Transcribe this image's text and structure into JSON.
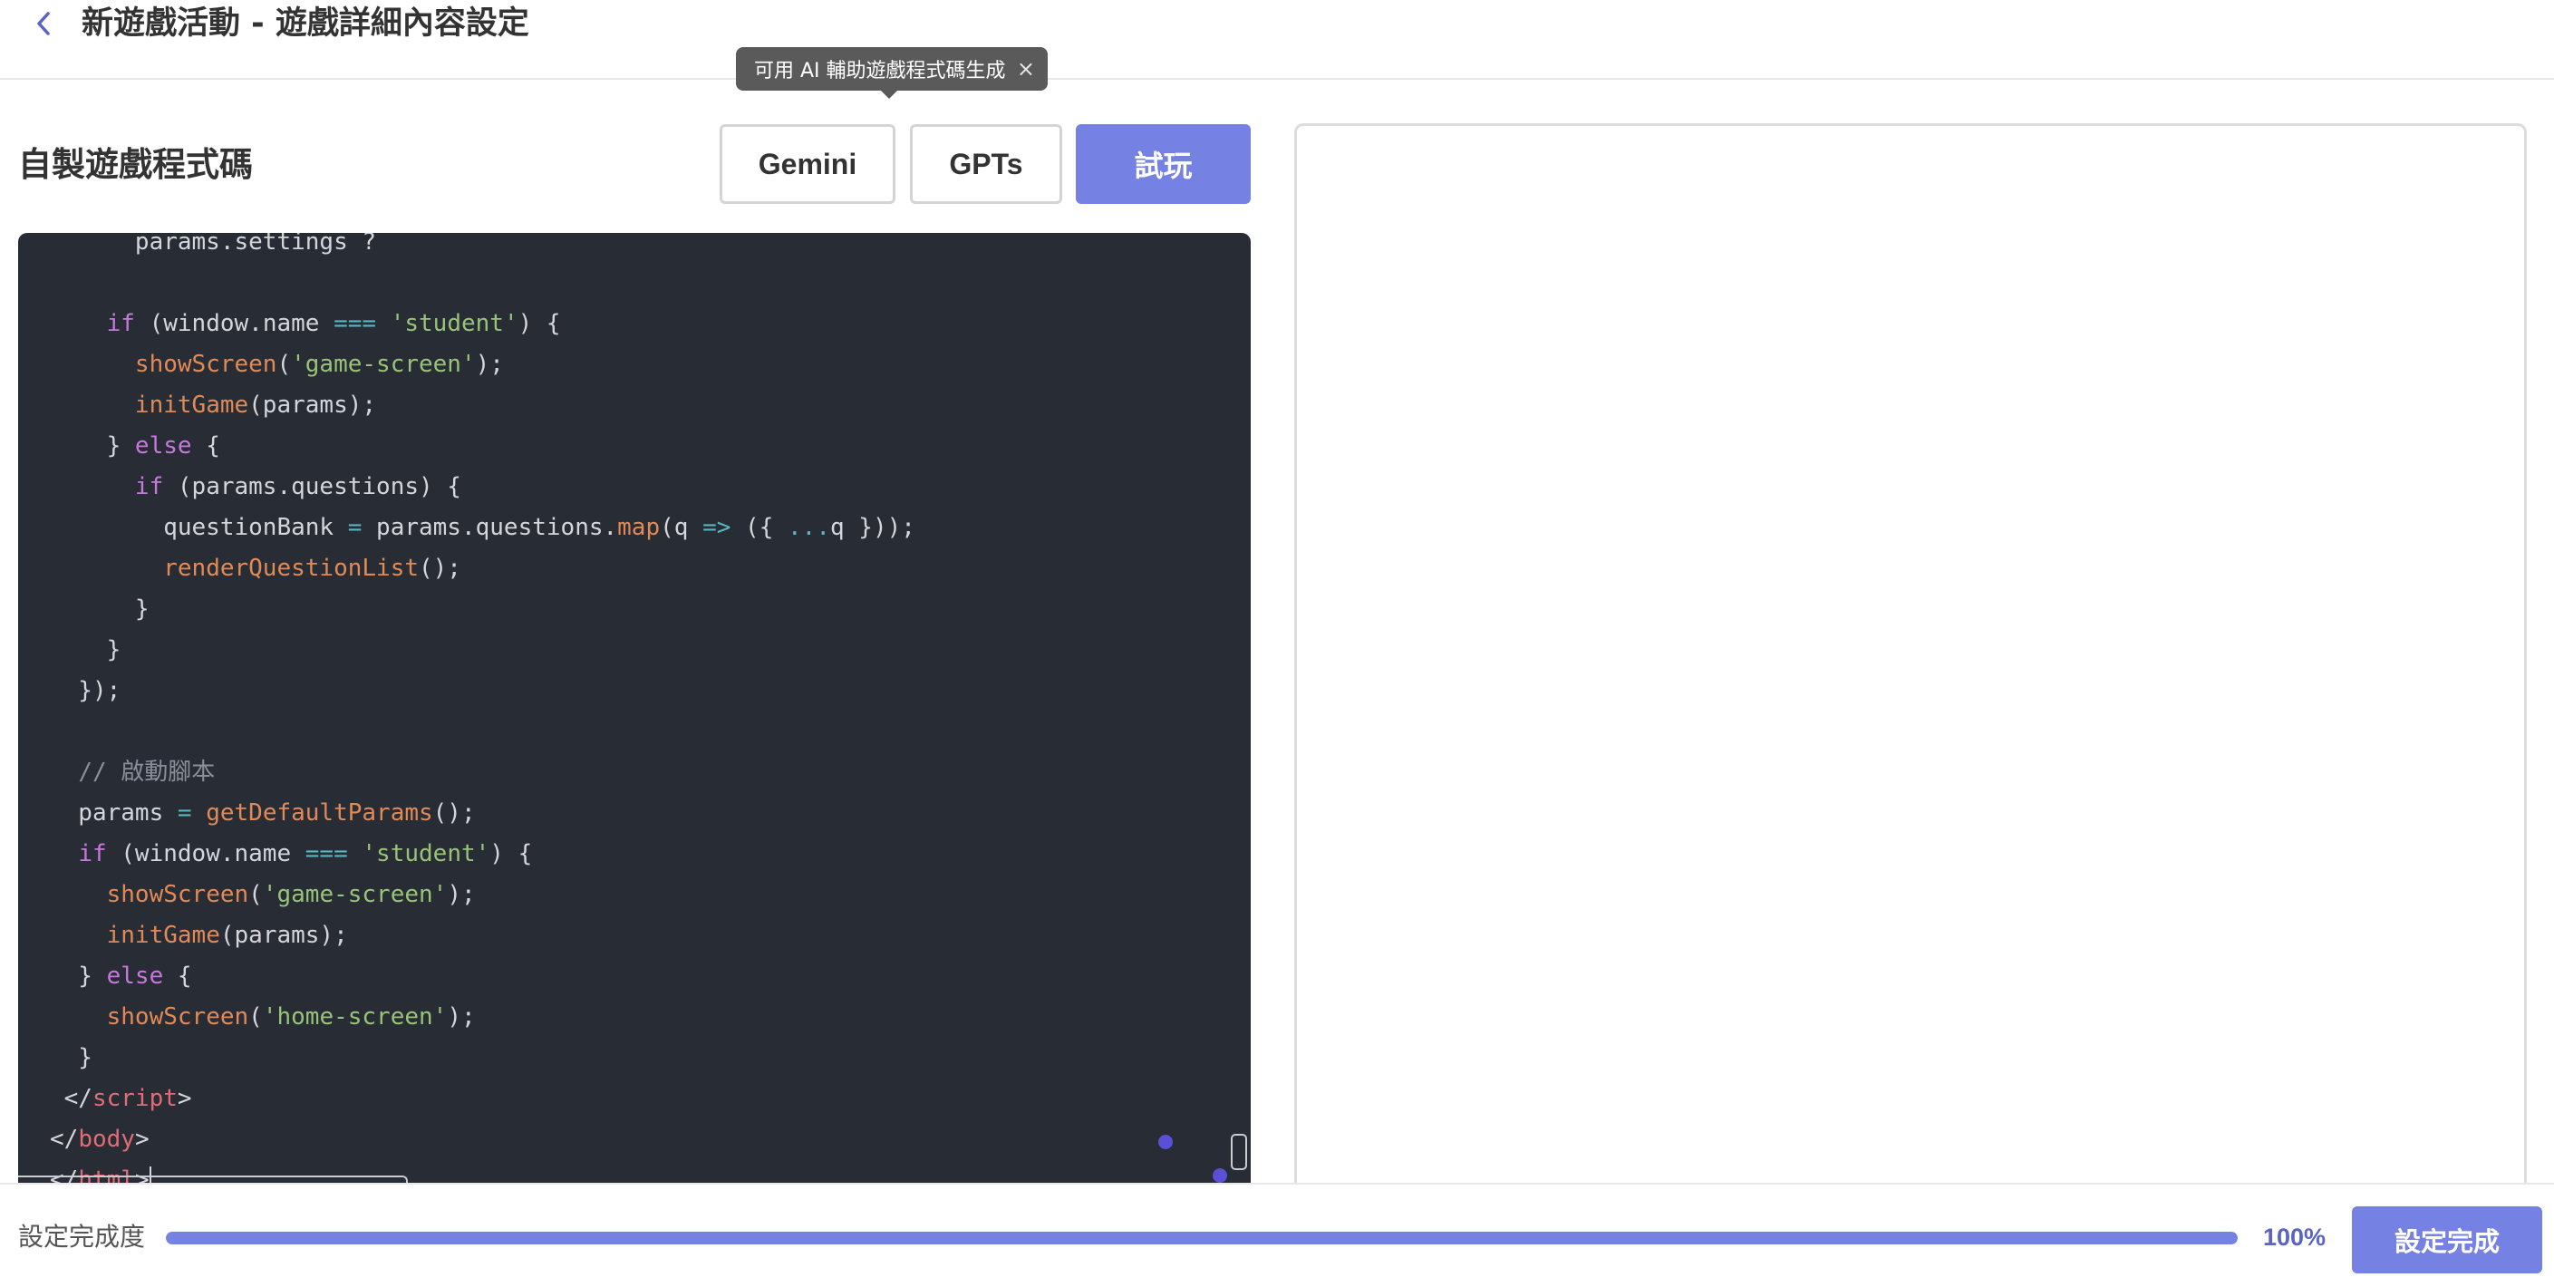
{
  "header": {
    "title": "新遊戲活動 - 遊戲詳細內容設定"
  },
  "tooltip": {
    "text": "可用 AI 輔助遊戲程式碼生成",
    "close_glyph": "×"
  },
  "left_panel": {
    "title": "自製遊戲程式碼",
    "buttons": {
      "gemini": "Gemini",
      "gpts": "GPTs",
      "try": "試玩"
    }
  },
  "editor": {
    "lines": [
      [
        {
          "t": "      params.settings ?",
          "c": ""
        }
      ],
      [
        {
          "t": "",
          "c": ""
        }
      ],
      [
        {
          "t": "    ",
          "c": ""
        },
        {
          "t": "if",
          "c": "kw"
        },
        {
          "t": " (window.name ",
          "c": ""
        },
        {
          "t": "===",
          "c": "op"
        },
        {
          "t": " ",
          "c": ""
        },
        {
          "t": "'student'",
          "c": "str"
        },
        {
          "t": ") {",
          "c": ""
        }
      ],
      [
        {
          "t": "      ",
          "c": ""
        },
        {
          "t": "showScreen",
          "c": "fn"
        },
        {
          "t": "(",
          "c": ""
        },
        {
          "t": "'game-screen'",
          "c": "str"
        },
        {
          "t": ");",
          "c": ""
        }
      ],
      [
        {
          "t": "      ",
          "c": ""
        },
        {
          "t": "initGame",
          "c": "fn"
        },
        {
          "t": "(params);",
          "c": ""
        }
      ],
      [
        {
          "t": "    } ",
          "c": ""
        },
        {
          "t": "else",
          "c": "kw"
        },
        {
          "t": " {",
          "c": ""
        }
      ],
      [
        {
          "t": "      ",
          "c": ""
        },
        {
          "t": "if",
          "c": "kw"
        },
        {
          "t": " (params.questions) {",
          "c": ""
        }
      ],
      [
        {
          "t": "        questionBank ",
          "c": ""
        },
        {
          "t": "=",
          "c": "op"
        },
        {
          "t": " params.questions.",
          "c": ""
        },
        {
          "t": "map",
          "c": "fn"
        },
        {
          "t": "(q ",
          "c": ""
        },
        {
          "t": "=>",
          "c": "op"
        },
        {
          "t": " ({ ",
          "c": ""
        },
        {
          "t": "...",
          "c": "op"
        },
        {
          "t": "q }));",
          "c": ""
        }
      ],
      [
        {
          "t": "        ",
          "c": ""
        },
        {
          "t": "renderQuestionList",
          "c": "fn"
        },
        {
          "t": "();",
          "c": ""
        }
      ],
      [
        {
          "t": "      }",
          "c": ""
        }
      ],
      [
        {
          "t": "    }",
          "c": ""
        }
      ],
      [
        {
          "t": "  });",
          "c": ""
        }
      ],
      [
        {
          "t": "",
          "c": ""
        }
      ],
      [
        {
          "t": "  ",
          "c": ""
        },
        {
          "t": "// 啟動腳本",
          "c": "cm"
        }
      ],
      [
        {
          "t": "  params ",
          "c": ""
        },
        {
          "t": "=",
          "c": "op"
        },
        {
          "t": " ",
          "c": ""
        },
        {
          "t": "getDefaultParams",
          "c": "fn"
        },
        {
          "t": "();",
          "c": ""
        }
      ],
      [
        {
          "t": "  ",
          "c": ""
        },
        {
          "t": "if",
          "c": "kw"
        },
        {
          "t": " (window.name ",
          "c": ""
        },
        {
          "t": "===",
          "c": "op"
        },
        {
          "t": " ",
          "c": ""
        },
        {
          "t": "'student'",
          "c": "str"
        },
        {
          "t": ") {",
          "c": ""
        }
      ],
      [
        {
          "t": "    ",
          "c": ""
        },
        {
          "t": "showScreen",
          "c": "fn"
        },
        {
          "t": "(",
          "c": ""
        },
        {
          "t": "'game-screen'",
          "c": "str"
        },
        {
          "t": ");",
          "c": ""
        }
      ],
      [
        {
          "t": "    ",
          "c": ""
        },
        {
          "t": "initGame",
          "c": "fn"
        },
        {
          "t": "(params);",
          "c": ""
        }
      ],
      [
        {
          "t": "  } ",
          "c": ""
        },
        {
          "t": "else",
          "c": "kw"
        },
        {
          "t": " {",
          "c": ""
        }
      ],
      [
        {
          "t": "    ",
          "c": ""
        },
        {
          "t": "showScreen",
          "c": "fn"
        },
        {
          "t": "(",
          "c": ""
        },
        {
          "t": "'home-screen'",
          "c": "str"
        },
        {
          "t": ");",
          "c": ""
        }
      ],
      [
        {
          "t": "  }",
          "c": ""
        }
      ],
      [
        {
          "t": " </",
          "c": ""
        },
        {
          "t": "script",
          "c": "tag"
        },
        {
          "t": ">",
          "c": ""
        }
      ],
      [
        {
          "t": "</",
          "c": ""
        },
        {
          "t": "body",
          "c": "tag"
        },
        {
          "t": ">",
          "c": ""
        }
      ],
      [
        {
          "t": "</",
          "c": ""
        },
        {
          "t": "html",
          "c": "tag"
        },
        {
          "t": ">",
          "c": ""
        }
      ]
    ]
  },
  "footer": {
    "progress_label": "設定完成度",
    "progress_value": 1.0,
    "progress_text": "100%",
    "done_button": "設定完成"
  },
  "colors": {
    "accent": "#7581e3",
    "editor_bg": "#282c34"
  }
}
